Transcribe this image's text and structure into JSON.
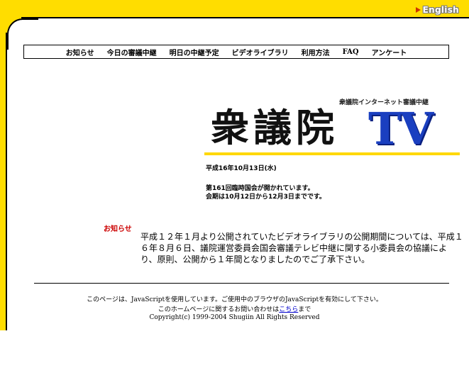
{
  "header": {
    "english_label": "English"
  },
  "menu": {
    "items": [
      "お知らせ",
      "今日の審議中継",
      "明日の中継予定",
      "ビデオライブラリ",
      "利用方法",
      "FAQ",
      "アンケート"
    ]
  },
  "brand": {
    "subtitle": "衆議院インターネット審議中継",
    "title": "衆議院",
    "tv": "TV"
  },
  "status": {
    "date": "平成16年10月13日(水)",
    "session_line1": "第161回臨時国会が開かれています。",
    "session_line2": "会期は10月12日から12月3日までです。"
  },
  "notice": {
    "label": "お知らせ",
    "body": "平成１２年１月より公開されていたビデオライブラリの公開期間については、平成１６年８月６日、議院運営委員会国会審議テレビ中継に関する小委員会の協議により、原則、公開から１年間となりましたのでご了承下さい。"
  },
  "footer": {
    "line1": "このページは、JavaScriptを使用しています。ご使用中のブラウザのJavaScriptを有効にして下さい。",
    "line2_prefix": "このホームページに関するお問い合わせは",
    "line2_link": "こちら",
    "line2_suffix": "まで",
    "line3": "Copyright(c) 1999-2004 Shugiin All Rights Reserved"
  },
  "colors": {
    "frame": "#ffdd00",
    "brand_rule": "#ffd800",
    "tv": "#1a3fc0",
    "notice_label": "#cc0000"
  }
}
